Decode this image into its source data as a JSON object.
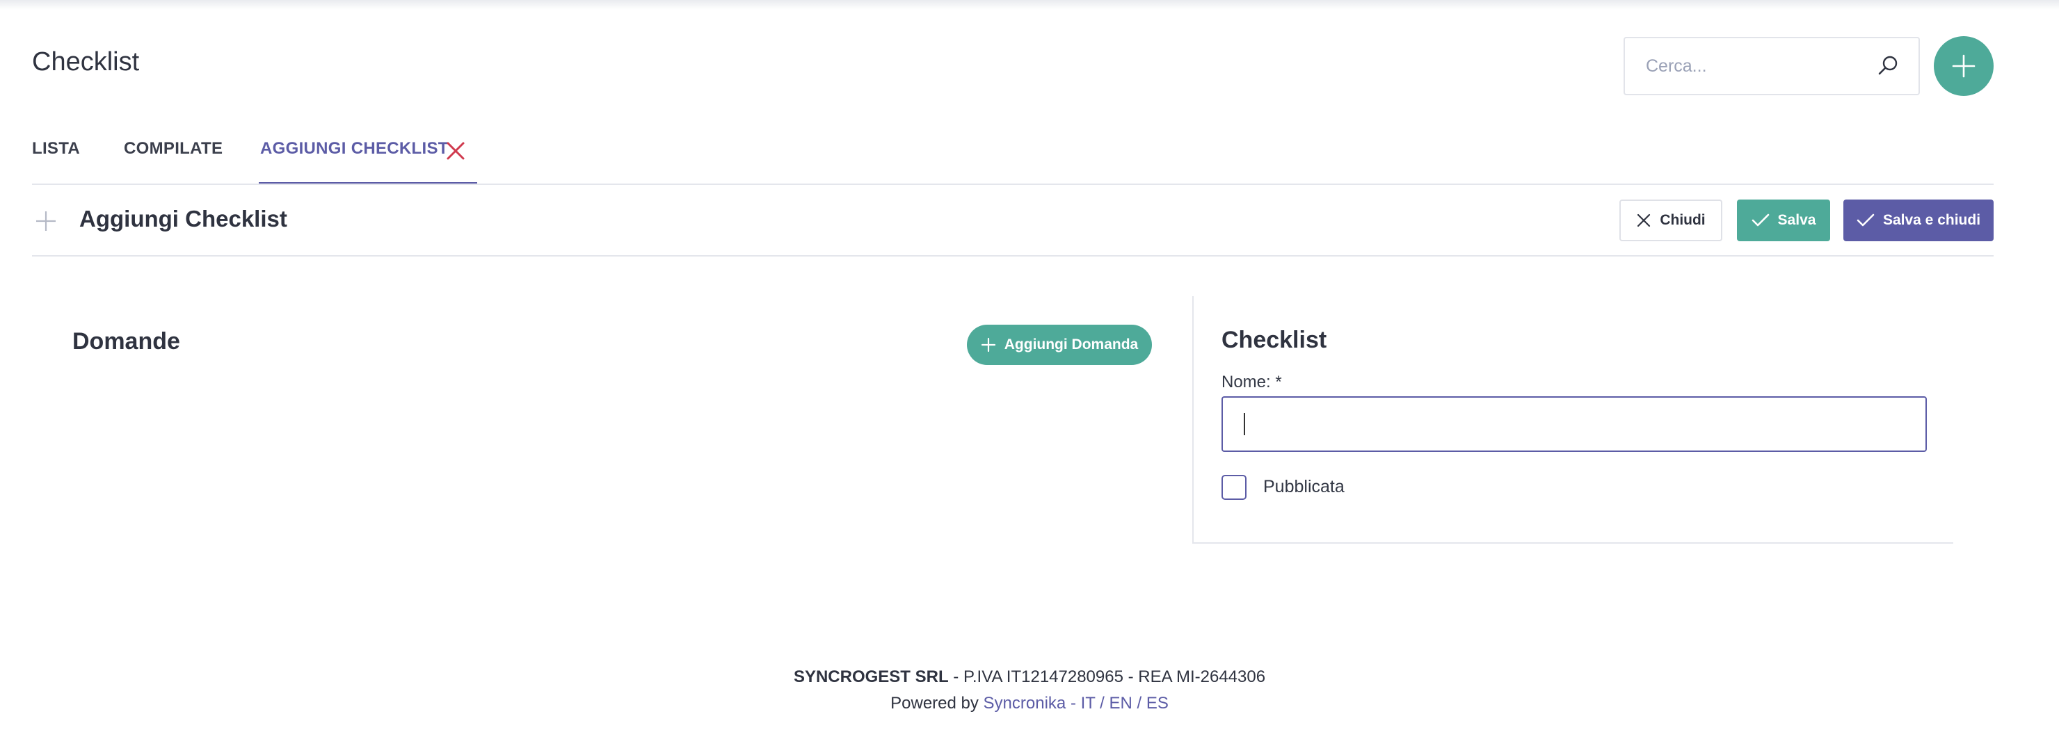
{
  "page": {
    "title": "Checklist"
  },
  "search": {
    "placeholder": "Cerca..."
  },
  "tabs": [
    {
      "label": "LISTA",
      "active": false
    },
    {
      "label": "COMPILATE",
      "active": false
    },
    {
      "label": "AGGIUNGI CHECKLIST",
      "active": true,
      "closable": true
    }
  ],
  "form": {
    "title": "Aggiungi Checklist",
    "buttons": {
      "close": "Chiudi",
      "save": "Salva",
      "save_close": "Salva e chiudi"
    }
  },
  "questions": {
    "title": "Domande",
    "add_button": "Aggiungi Domanda"
  },
  "checklist": {
    "title": "Checklist",
    "name_label": "Nome: *",
    "name_value": "",
    "published_label": "Pubblicata",
    "published_checked": false
  },
  "footer": {
    "company": "SYNCROGEST SRL",
    "details": " - P.IVA IT12147280965 - REA MI-2644306",
    "powered_by": "Powered by ",
    "link": "Syncronika - IT / EN / ES"
  },
  "colors": {
    "primary": "#5c5ca6",
    "accent": "#4eaa99",
    "danger": "#d03a4e",
    "text": "#2f3340",
    "border": "#e4e6ec"
  },
  "icons": {
    "search": "search-icon",
    "add": "plus-icon",
    "close_tab": "close-icon",
    "check": "check-icon"
  }
}
